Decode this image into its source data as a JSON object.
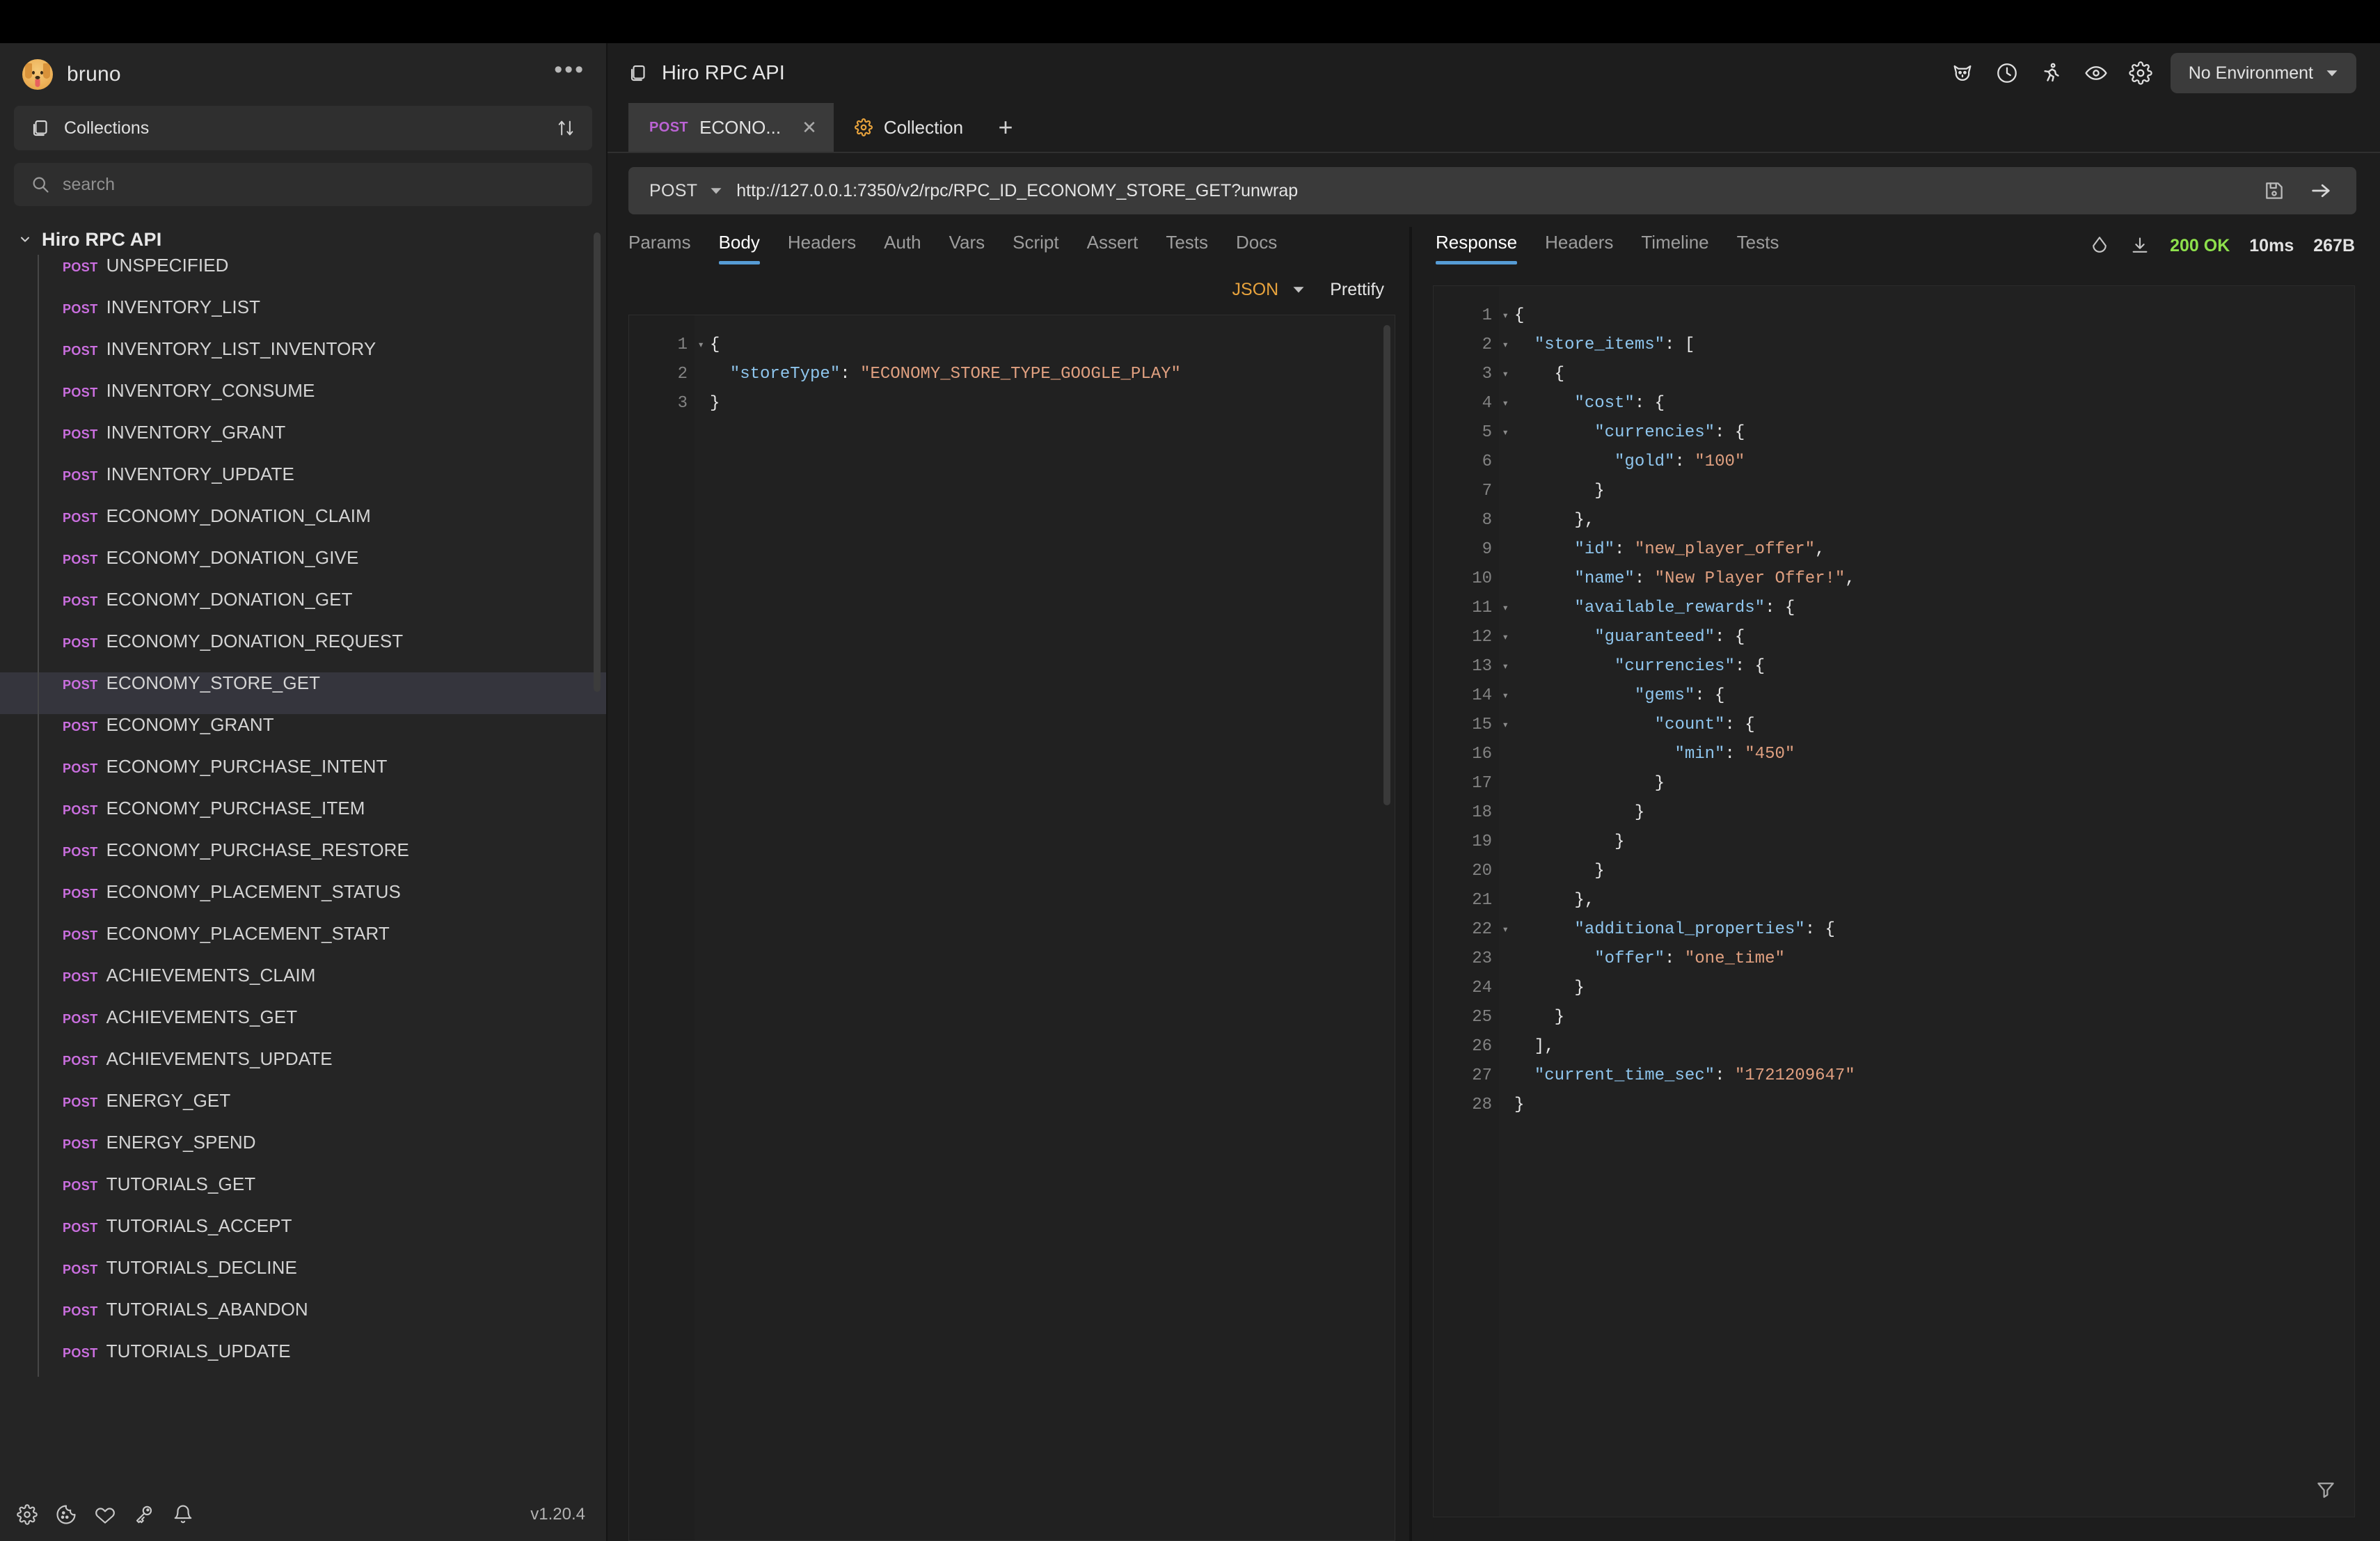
{
  "app": {
    "name": "bruno",
    "version": "v1.20.4"
  },
  "sidebar": {
    "collections_label": "Collections",
    "search_placeholder": "search",
    "search_value": "",
    "collection_name": "Hiro RPC API",
    "method_label": "POST",
    "requests": [
      "UNSPECIFIED",
      "INVENTORY_LIST",
      "INVENTORY_LIST_INVENTORY",
      "INVENTORY_CONSUME",
      "INVENTORY_GRANT",
      "INVENTORY_UPDATE",
      "ECONOMY_DONATION_CLAIM",
      "ECONOMY_DONATION_GIVE",
      "ECONOMY_DONATION_GET",
      "ECONOMY_DONATION_REQUEST",
      "ECONOMY_STORE_GET",
      "ECONOMY_GRANT",
      "ECONOMY_PURCHASE_INTENT",
      "ECONOMY_PURCHASE_ITEM",
      "ECONOMY_PURCHASE_RESTORE",
      "ECONOMY_PLACEMENT_STATUS",
      "ECONOMY_PLACEMENT_START",
      "ACHIEVEMENTS_CLAIM",
      "ACHIEVEMENTS_GET",
      "ACHIEVEMENTS_UPDATE",
      "ENERGY_GET",
      "ENERGY_SPEND",
      "TUTORIALS_GET",
      "TUTORIALS_ACCEPT",
      "TUTORIALS_DECLINE",
      "TUTORIALS_ABANDON",
      "TUTORIALS_UPDATE"
    ],
    "selected_request": "ECONOMY_STORE_GET",
    "footer_icons": [
      "gear-icon",
      "cookie-icon",
      "heart-icon",
      "key-icon",
      "bell-icon"
    ]
  },
  "header": {
    "title": "Hiro RPC API",
    "icons": [
      "dog-icon",
      "clock-icon",
      "runner-icon",
      "eye-icon",
      "gear-icon"
    ],
    "environment_label": "No Environment"
  },
  "tabs": {
    "items": [
      {
        "method": "POST",
        "label": "ECONO...",
        "closable": true,
        "active": true
      },
      {
        "icon": "gear-icon",
        "label": "Collection",
        "closable": false,
        "active": false
      }
    ],
    "new_tab_label": "+"
  },
  "request": {
    "method": "POST",
    "url": "http://127.0.0.1:7350/v2/rpc/RPC_ID_ECONOMY_STORE_GET?unwrap",
    "tabs": [
      "Params",
      "Body",
      "Headers",
      "Auth",
      "Vars",
      "Script",
      "Assert",
      "Tests",
      "Docs"
    ],
    "active_tab": "Body",
    "body_type": "JSON",
    "prettify_label": "Prettify",
    "body_lines": [
      {
        "n": "1",
        "fold": true,
        "tokens": [
          {
            "t": "p",
            "v": "{"
          }
        ]
      },
      {
        "n": "2",
        "fold": false,
        "tokens": [
          {
            "t": "p",
            "v": "  "
          },
          {
            "t": "k",
            "v": "\"storeType\""
          },
          {
            "t": "p",
            "v": ": "
          },
          {
            "t": "s",
            "v": "\"ECONOMY_STORE_TYPE_GOOGLE_PLAY\""
          }
        ]
      },
      {
        "n": "3",
        "fold": false,
        "tokens": [
          {
            "t": "p",
            "v": "}"
          }
        ]
      }
    ]
  },
  "response": {
    "tabs": [
      "Response",
      "Headers",
      "Timeline",
      "Tests"
    ],
    "active_tab": "Response",
    "status": "200 OK",
    "time": "10ms",
    "size": "267B",
    "lines": [
      {
        "n": "1",
        "fold": true,
        "tokens": [
          {
            "t": "p",
            "v": "{"
          }
        ]
      },
      {
        "n": "2",
        "fold": true,
        "tokens": [
          {
            "t": "p",
            "v": "  "
          },
          {
            "t": "k",
            "v": "\"store_items\""
          },
          {
            "t": "p",
            "v": ": ["
          }
        ]
      },
      {
        "n": "3",
        "fold": true,
        "tokens": [
          {
            "t": "p",
            "v": "    {"
          }
        ]
      },
      {
        "n": "4",
        "fold": true,
        "tokens": [
          {
            "t": "p",
            "v": "      "
          },
          {
            "t": "k",
            "v": "\"cost\""
          },
          {
            "t": "p",
            "v": ": {"
          }
        ]
      },
      {
        "n": "5",
        "fold": true,
        "tokens": [
          {
            "t": "p",
            "v": "        "
          },
          {
            "t": "k",
            "v": "\"currencies\""
          },
          {
            "t": "p",
            "v": ": {"
          }
        ]
      },
      {
        "n": "6",
        "fold": false,
        "tokens": [
          {
            "t": "p",
            "v": "          "
          },
          {
            "t": "k",
            "v": "\"gold\""
          },
          {
            "t": "p",
            "v": ": "
          },
          {
            "t": "s",
            "v": "\"100\""
          }
        ]
      },
      {
        "n": "7",
        "fold": false,
        "tokens": [
          {
            "t": "p",
            "v": "        }"
          }
        ]
      },
      {
        "n": "8",
        "fold": false,
        "tokens": [
          {
            "t": "p",
            "v": "      },"
          }
        ]
      },
      {
        "n": "9",
        "fold": false,
        "tokens": [
          {
            "t": "p",
            "v": "      "
          },
          {
            "t": "k",
            "v": "\"id\""
          },
          {
            "t": "p",
            "v": ": "
          },
          {
            "t": "s",
            "v": "\"new_player_offer\""
          },
          {
            "t": "p",
            "v": ","
          }
        ]
      },
      {
        "n": "10",
        "fold": false,
        "tokens": [
          {
            "t": "p",
            "v": "      "
          },
          {
            "t": "k",
            "v": "\"name\""
          },
          {
            "t": "p",
            "v": ": "
          },
          {
            "t": "s",
            "v": "\"New Player Offer!\""
          },
          {
            "t": "p",
            "v": ","
          }
        ]
      },
      {
        "n": "11",
        "fold": true,
        "tokens": [
          {
            "t": "p",
            "v": "      "
          },
          {
            "t": "k",
            "v": "\"available_rewards\""
          },
          {
            "t": "p",
            "v": ": {"
          }
        ]
      },
      {
        "n": "12",
        "fold": true,
        "tokens": [
          {
            "t": "p",
            "v": "        "
          },
          {
            "t": "k",
            "v": "\"guaranteed\""
          },
          {
            "t": "p",
            "v": ": {"
          }
        ]
      },
      {
        "n": "13",
        "fold": true,
        "tokens": [
          {
            "t": "p",
            "v": "          "
          },
          {
            "t": "k",
            "v": "\"currencies\""
          },
          {
            "t": "p",
            "v": ": {"
          }
        ]
      },
      {
        "n": "14",
        "fold": true,
        "tokens": [
          {
            "t": "p",
            "v": "            "
          },
          {
            "t": "k",
            "v": "\"gems\""
          },
          {
            "t": "p",
            "v": ": {"
          }
        ]
      },
      {
        "n": "15",
        "fold": true,
        "tokens": [
          {
            "t": "p",
            "v": "              "
          },
          {
            "t": "k",
            "v": "\"count\""
          },
          {
            "t": "p",
            "v": ": {"
          }
        ]
      },
      {
        "n": "16",
        "fold": false,
        "tokens": [
          {
            "t": "p",
            "v": "                "
          },
          {
            "t": "k",
            "v": "\"min\""
          },
          {
            "t": "p",
            "v": ": "
          },
          {
            "t": "s",
            "v": "\"450\""
          }
        ]
      },
      {
        "n": "17",
        "fold": false,
        "tokens": [
          {
            "t": "p",
            "v": "              }"
          }
        ]
      },
      {
        "n": "18",
        "fold": false,
        "tokens": [
          {
            "t": "p",
            "v": "            }"
          }
        ]
      },
      {
        "n": "19",
        "fold": false,
        "tokens": [
          {
            "t": "p",
            "v": "          }"
          }
        ]
      },
      {
        "n": "20",
        "fold": false,
        "tokens": [
          {
            "t": "p",
            "v": "        }"
          }
        ]
      },
      {
        "n": "21",
        "fold": false,
        "tokens": [
          {
            "t": "p",
            "v": "      },"
          }
        ]
      },
      {
        "n": "22",
        "fold": true,
        "tokens": [
          {
            "t": "p",
            "v": "      "
          },
          {
            "t": "k",
            "v": "\"additional_properties\""
          },
          {
            "t": "p",
            "v": ": {"
          }
        ]
      },
      {
        "n": "23",
        "fold": false,
        "tokens": [
          {
            "t": "p",
            "v": "        "
          },
          {
            "t": "k",
            "v": "\"offer\""
          },
          {
            "t": "p",
            "v": ": "
          },
          {
            "t": "s",
            "v": "\"one_time\""
          }
        ]
      },
      {
        "n": "24",
        "fold": false,
        "tokens": [
          {
            "t": "p",
            "v": "      }"
          }
        ]
      },
      {
        "n": "25",
        "fold": false,
        "tokens": [
          {
            "t": "p",
            "v": "    }"
          }
        ]
      },
      {
        "n": "26",
        "fold": false,
        "tokens": [
          {
            "t": "p",
            "v": "  ],"
          }
        ]
      },
      {
        "n": "27",
        "fold": false,
        "tokens": [
          {
            "t": "p",
            "v": "  "
          },
          {
            "t": "k",
            "v": "\"current_time_sec\""
          },
          {
            "t": "p",
            "v": ": "
          },
          {
            "t": "s",
            "v": "\"1721209647\""
          }
        ]
      },
      {
        "n": "28",
        "fold": false,
        "tokens": [
          {
            "t": "p",
            "v": "}"
          }
        ]
      }
    ]
  },
  "colors": {
    "accent_blue": "#569cd6",
    "method_purple": "#cb6fe0",
    "status_green": "#8ee04c",
    "json_orange": "#e8a33d",
    "sidebar_bg": "#252525",
    "main_bg": "#1d1d1d",
    "editor_bg": "#212121"
  }
}
